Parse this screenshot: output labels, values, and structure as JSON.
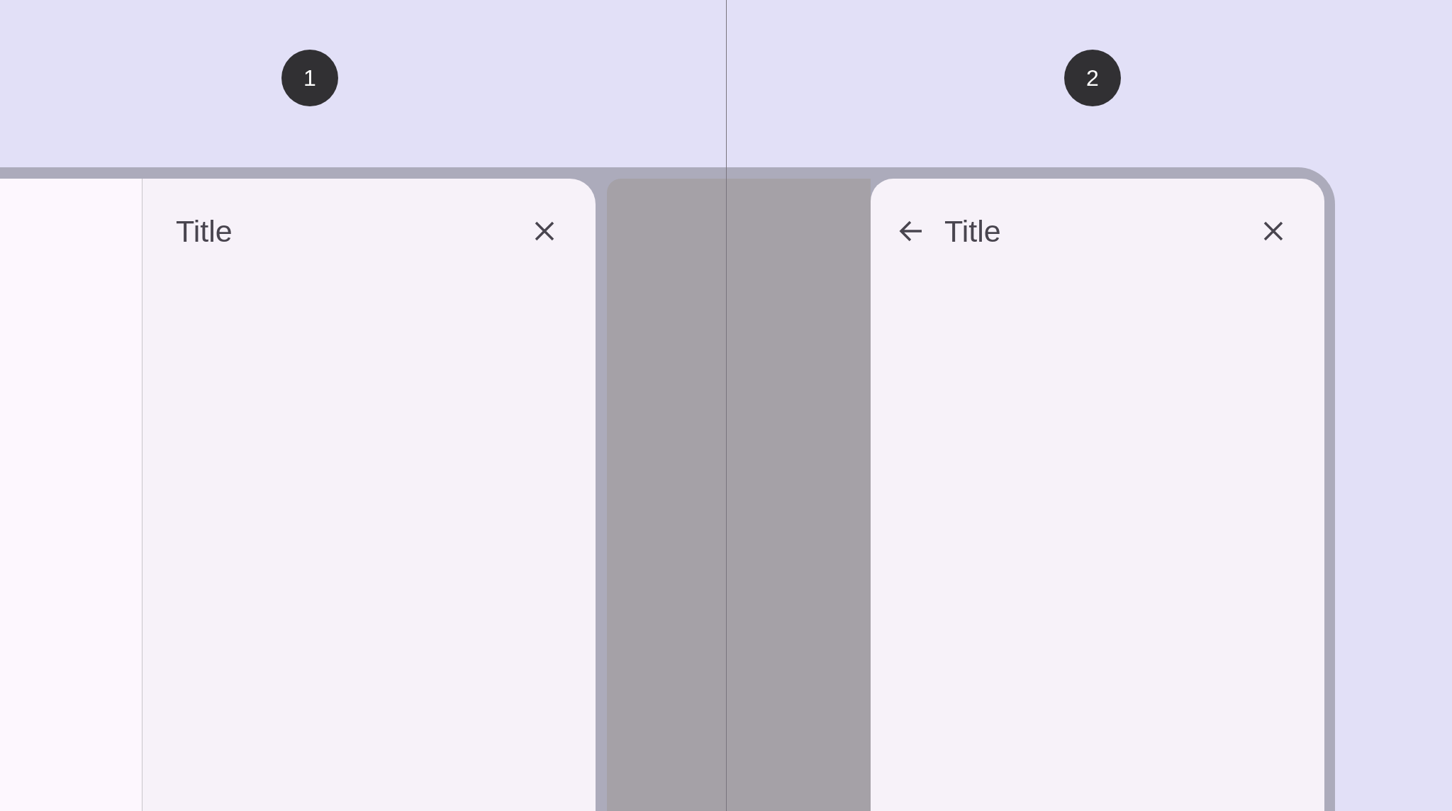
{
  "markers": [
    {
      "label": "1"
    },
    {
      "label": "2"
    }
  ],
  "screens": [
    {
      "kind": "standard",
      "sheet": {
        "title": "Title",
        "has_back": false
      }
    },
    {
      "kind": "modal",
      "sheet": {
        "title": "Title",
        "has_back": true
      }
    }
  ]
}
